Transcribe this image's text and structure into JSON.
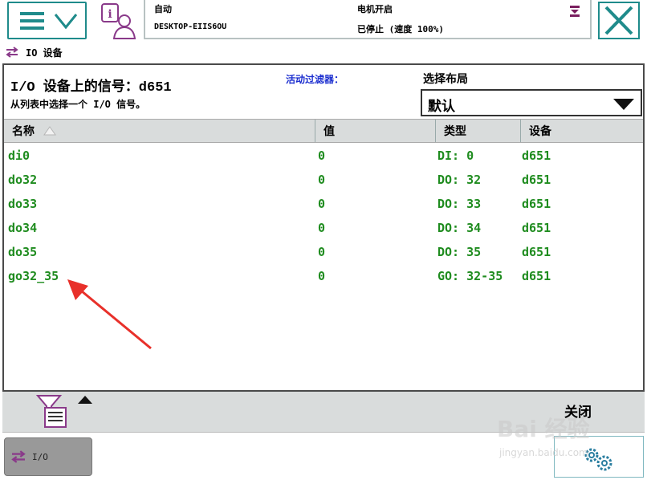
{
  "status": {
    "mode": "自动",
    "host": "DESKTOP-EIIS6OU",
    "motor": "电机开启",
    "state": "已停止 (速度 100%)"
  },
  "breadcrumb": {
    "label": "IO 设备"
  },
  "signals": {
    "title": "I/O 设备上的信号：d651",
    "subtitle": "从列表中选择一个 I/O 信号。",
    "filter_label": "活动过滤器：",
    "layout_label": "选择布局",
    "layout_value": "默认"
  },
  "table": {
    "columns": [
      "名称",
      "值",
      "类型",
      "设备"
    ],
    "rows": [
      {
        "name": "di0",
        "value": "0",
        "type": "DI: 0",
        "device": "d651"
      },
      {
        "name": "do32",
        "value": "0",
        "type": "DO: 32",
        "device": "d651"
      },
      {
        "name": "do33",
        "value": "0",
        "type": "DO: 33",
        "device": "d651"
      },
      {
        "name": "do34",
        "value": "0",
        "type": "DO: 34",
        "device": "d651"
      },
      {
        "name": "do35",
        "value": "0",
        "type": "DO: 35",
        "device": "d651"
      },
      {
        "name": "go32_35",
        "value": "0",
        "type": "GO: 32-35",
        "device": "d651"
      }
    ]
  },
  "toolbar": {
    "close_label": "关闭"
  },
  "taskbar": {
    "io_label": "I/O"
  },
  "watermark": {
    "brand": "Bai 经验",
    "url": "jingyan.baidu.com"
  },
  "colors": {
    "accent": "#1f8b8b",
    "signal_text": "#1f8c1f",
    "filter_label": "#1a2dcf",
    "annotation": "#e8302a"
  },
  "icons": {
    "menu": "hamburger-menu-icon",
    "info": "info-user-icon",
    "close": "close-x-icon",
    "io": "io-arrows-icon",
    "filter": "filter-funnel-icon",
    "sort": "sort-ascending-icon",
    "settings": "gears-icon"
  }
}
